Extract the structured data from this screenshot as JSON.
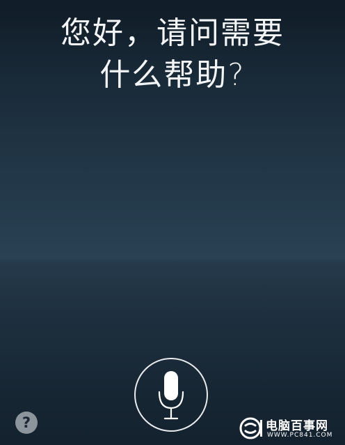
{
  "siri": {
    "prompt_line1": "您好，请问需要",
    "prompt_line2": "什么帮助?"
  },
  "controls": {
    "mic_icon": "microphone-icon",
    "help_label": "?"
  },
  "watermark": {
    "title": "电脑百事网",
    "url": "WWW.PC841.COM"
  },
  "colors": {
    "background_top": "#101c27",
    "background_mid": "#294153",
    "background_bottom": "#142230",
    "text": "#f3f5f7",
    "mic": "#ffffff",
    "help_badge": "#8c959c"
  }
}
